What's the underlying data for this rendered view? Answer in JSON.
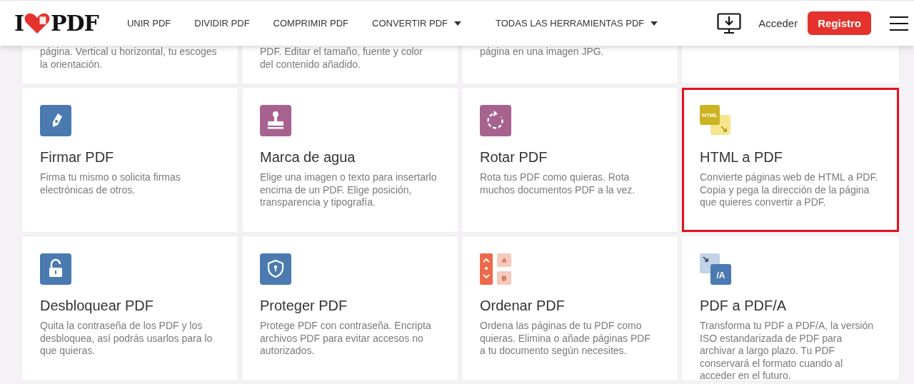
{
  "header": {
    "logo": {
      "left": "I",
      "right": "PDF"
    },
    "nav": [
      {
        "label": "UNIR PDF",
        "has_menu": false
      },
      {
        "label": "DIVIDIR PDF",
        "has_menu": false
      },
      {
        "label": "COMPRIMIR PDF",
        "has_menu": false
      },
      {
        "label": "CONVERTIR PDF",
        "has_menu": true
      },
      {
        "label": "TODAS LAS HERRAMIENTAS PDF",
        "has_menu": true
      }
    ],
    "login": "Acceder",
    "signup": "Registro"
  },
  "top_row": [
    {
      "description": "página. Vertical u horizontal, tu escoges la orientación."
    },
    {
      "description": "PDF. Editar el tamaño, fuente y color del contenido añadido."
    },
    {
      "description": "página en una imagen JPG."
    }
  ],
  "tools": [
    {
      "kind": "sign",
      "title": "Firmar PDF",
      "description": "Firma tu mismo o solicita firmas electrónicas de otros.",
      "highlighted": false
    },
    {
      "kind": "stamp",
      "title": "Marca de agua",
      "description": "Elige una imagen o texto para insertarlo encima de un PDF. Elige posición, transparencia y tipografía.",
      "highlighted": false
    },
    {
      "kind": "rotate",
      "title": "Rotar PDF",
      "description": "Rota tus PDF como quieras. Rota muchos documentos PDF a la vez.",
      "highlighted": false
    },
    {
      "kind": "html",
      "title": "HTML a PDF",
      "description": "Convierte páginas web de HTML a PDF. Copia y pega la dirección de la página que quieres convertir a PDF.",
      "highlighted": true,
      "icon_text": "HTML"
    },
    {
      "kind": "unlock",
      "title": "Desbloquear PDF",
      "description": "Quita la contraseña de los PDF y los desbloquea, así podrás usarlos para lo que quieras.",
      "highlighted": false
    },
    {
      "kind": "shield",
      "title": "Proteger PDF",
      "description": "Protege PDF con contraseña. Encripta archivos PDF para evitar accesos no autorizados.",
      "highlighted": false
    },
    {
      "kind": "order",
      "title": "Ordenar PDF",
      "description": "Ordena las páginas de tu PDF como quieras. Elimina o añade páginas PDF a tu documento según necesites.",
      "highlighted": false,
      "icon_text": [
        "A",
        "B"
      ]
    },
    {
      "kind": "pdfa",
      "title": "PDF a PDF/A",
      "description": "Transforma tu PDF a PDF/A, la versión ISO estandarizada de PDF para archivar a largo plazo. Tu PDF conservará el formato cuando al acceder en el futuro.",
      "highlighted": false,
      "icon_text": "/A"
    }
  ]
}
